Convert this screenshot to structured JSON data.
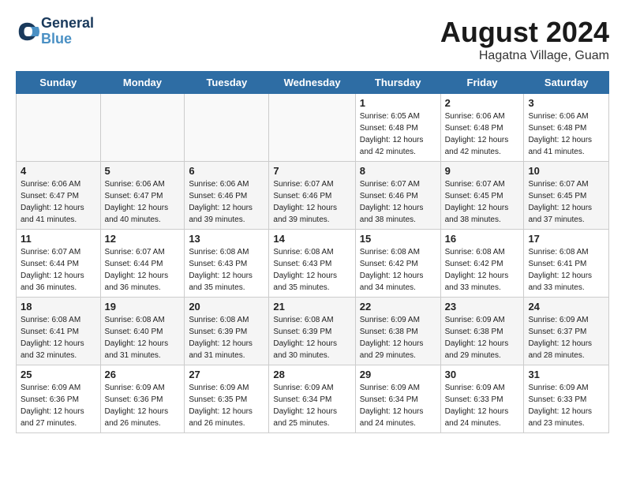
{
  "header": {
    "logo_line1": "General",
    "logo_line2": "Blue",
    "main_title": "August 2024",
    "sub_title": "Hagatna Village, Guam"
  },
  "weekdays": [
    "Sunday",
    "Monday",
    "Tuesday",
    "Wednesday",
    "Thursday",
    "Friday",
    "Saturday"
  ],
  "weeks": [
    [
      {
        "day": "",
        "info": ""
      },
      {
        "day": "",
        "info": ""
      },
      {
        "day": "",
        "info": ""
      },
      {
        "day": "",
        "info": ""
      },
      {
        "day": "1",
        "info": "Sunrise: 6:05 AM\nSunset: 6:48 PM\nDaylight: 12 hours\nand 42 minutes."
      },
      {
        "day": "2",
        "info": "Sunrise: 6:06 AM\nSunset: 6:48 PM\nDaylight: 12 hours\nand 42 minutes."
      },
      {
        "day": "3",
        "info": "Sunrise: 6:06 AM\nSunset: 6:48 PM\nDaylight: 12 hours\nand 41 minutes."
      }
    ],
    [
      {
        "day": "4",
        "info": "Sunrise: 6:06 AM\nSunset: 6:47 PM\nDaylight: 12 hours\nand 41 minutes."
      },
      {
        "day": "5",
        "info": "Sunrise: 6:06 AM\nSunset: 6:47 PM\nDaylight: 12 hours\nand 40 minutes."
      },
      {
        "day": "6",
        "info": "Sunrise: 6:06 AM\nSunset: 6:46 PM\nDaylight: 12 hours\nand 39 minutes."
      },
      {
        "day": "7",
        "info": "Sunrise: 6:07 AM\nSunset: 6:46 PM\nDaylight: 12 hours\nand 39 minutes."
      },
      {
        "day": "8",
        "info": "Sunrise: 6:07 AM\nSunset: 6:46 PM\nDaylight: 12 hours\nand 38 minutes."
      },
      {
        "day": "9",
        "info": "Sunrise: 6:07 AM\nSunset: 6:45 PM\nDaylight: 12 hours\nand 38 minutes."
      },
      {
        "day": "10",
        "info": "Sunrise: 6:07 AM\nSunset: 6:45 PM\nDaylight: 12 hours\nand 37 minutes."
      }
    ],
    [
      {
        "day": "11",
        "info": "Sunrise: 6:07 AM\nSunset: 6:44 PM\nDaylight: 12 hours\nand 36 minutes."
      },
      {
        "day": "12",
        "info": "Sunrise: 6:07 AM\nSunset: 6:44 PM\nDaylight: 12 hours\nand 36 minutes."
      },
      {
        "day": "13",
        "info": "Sunrise: 6:08 AM\nSunset: 6:43 PM\nDaylight: 12 hours\nand 35 minutes."
      },
      {
        "day": "14",
        "info": "Sunrise: 6:08 AM\nSunset: 6:43 PM\nDaylight: 12 hours\nand 35 minutes."
      },
      {
        "day": "15",
        "info": "Sunrise: 6:08 AM\nSunset: 6:42 PM\nDaylight: 12 hours\nand 34 minutes."
      },
      {
        "day": "16",
        "info": "Sunrise: 6:08 AM\nSunset: 6:42 PM\nDaylight: 12 hours\nand 33 minutes."
      },
      {
        "day": "17",
        "info": "Sunrise: 6:08 AM\nSunset: 6:41 PM\nDaylight: 12 hours\nand 33 minutes."
      }
    ],
    [
      {
        "day": "18",
        "info": "Sunrise: 6:08 AM\nSunset: 6:41 PM\nDaylight: 12 hours\nand 32 minutes."
      },
      {
        "day": "19",
        "info": "Sunrise: 6:08 AM\nSunset: 6:40 PM\nDaylight: 12 hours\nand 31 minutes."
      },
      {
        "day": "20",
        "info": "Sunrise: 6:08 AM\nSunset: 6:39 PM\nDaylight: 12 hours\nand 31 minutes."
      },
      {
        "day": "21",
        "info": "Sunrise: 6:08 AM\nSunset: 6:39 PM\nDaylight: 12 hours\nand 30 minutes."
      },
      {
        "day": "22",
        "info": "Sunrise: 6:09 AM\nSunset: 6:38 PM\nDaylight: 12 hours\nand 29 minutes."
      },
      {
        "day": "23",
        "info": "Sunrise: 6:09 AM\nSunset: 6:38 PM\nDaylight: 12 hours\nand 29 minutes."
      },
      {
        "day": "24",
        "info": "Sunrise: 6:09 AM\nSunset: 6:37 PM\nDaylight: 12 hours\nand 28 minutes."
      }
    ],
    [
      {
        "day": "25",
        "info": "Sunrise: 6:09 AM\nSunset: 6:36 PM\nDaylight: 12 hours\nand 27 minutes."
      },
      {
        "day": "26",
        "info": "Sunrise: 6:09 AM\nSunset: 6:36 PM\nDaylight: 12 hours\nand 26 minutes."
      },
      {
        "day": "27",
        "info": "Sunrise: 6:09 AM\nSunset: 6:35 PM\nDaylight: 12 hours\nand 26 minutes."
      },
      {
        "day": "28",
        "info": "Sunrise: 6:09 AM\nSunset: 6:34 PM\nDaylight: 12 hours\nand 25 minutes."
      },
      {
        "day": "29",
        "info": "Sunrise: 6:09 AM\nSunset: 6:34 PM\nDaylight: 12 hours\nand 24 minutes."
      },
      {
        "day": "30",
        "info": "Sunrise: 6:09 AM\nSunset: 6:33 PM\nDaylight: 12 hours\nand 24 minutes."
      },
      {
        "day": "31",
        "info": "Sunrise: 6:09 AM\nSunset: 6:33 PM\nDaylight: 12 hours\nand 23 minutes."
      }
    ]
  ]
}
